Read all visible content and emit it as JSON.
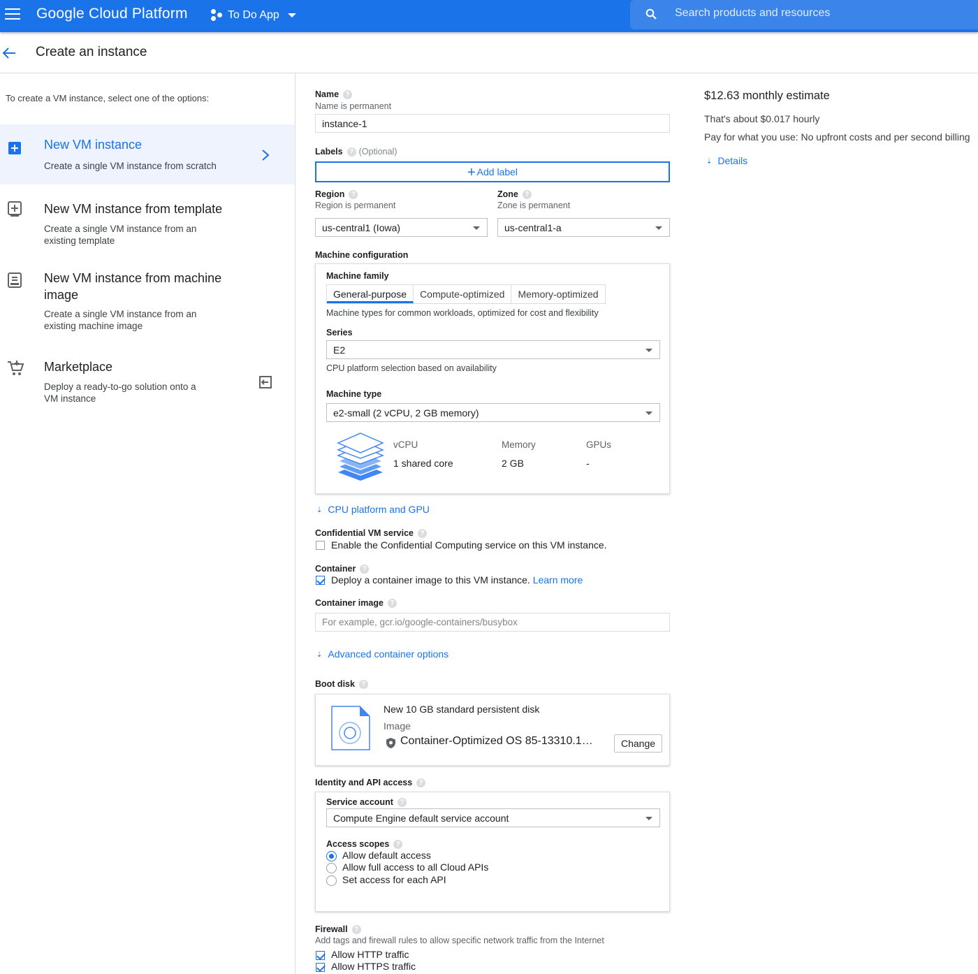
{
  "topbar": {
    "brand": "Google Cloud Platform",
    "project": "To Do App",
    "search_placeholder": "Search products and resources"
  },
  "page": {
    "title": "Create an instance"
  },
  "left": {
    "intro": "To create a VM instance, select one of the options:",
    "options": [
      {
        "title": "New VM instance",
        "desc": "Create a single VM instance from scratch",
        "selected": true
      },
      {
        "title": "New VM instance from template",
        "desc": "Create a single VM instance from an existing template"
      },
      {
        "title": "New VM instance from machine image",
        "desc": "Create a single VM instance from an existing machine image"
      },
      {
        "title": "Marketplace",
        "desc": "Deploy a ready-to-go solution onto a VM instance"
      }
    ]
  },
  "form": {
    "name_label": "Name",
    "name_hint": "Name is permanent",
    "name_value": "instance-1",
    "labels_label": "Labels",
    "labels_optional": "(Optional)",
    "add_label": "Add label",
    "region_label": "Region",
    "region_hint": "Region is permanent",
    "region_value": "us-central1 (Iowa)",
    "zone_label": "Zone",
    "zone_hint": "Zone is permanent",
    "zone_value": "us-central1-a",
    "machine_config_label": "Machine configuration",
    "machine_family_label": "Machine family",
    "tabs": [
      "General-purpose",
      "Compute-optimized",
      "Memory-optimized"
    ],
    "family_desc": "Machine types for common workloads, optimized for cost and flexibility",
    "series_label": "Series",
    "series_value": "E2",
    "series_hint": "CPU platform selection based on availability",
    "machine_type_label": "Machine type",
    "machine_type_value": "e2-small (2 vCPU, 2 GB memory)",
    "specs": {
      "vcpu_h": "vCPU",
      "vcpu_v": "1 shared core",
      "mem_h": "Memory",
      "mem_v": "2 GB",
      "gpu_h": "GPUs",
      "gpu_v": "-"
    },
    "cpu_gpu_link": "CPU platform and GPU",
    "confidential_label": "Confidential VM service",
    "confidential_text": "Enable the Confidential Computing service on this VM instance.",
    "container_label": "Container",
    "container_text": "Deploy a container image to this VM instance.",
    "learn_more": "Learn more",
    "container_image_label": "Container image",
    "container_image_placeholder": "For example, gcr.io/google-containers/busybox",
    "adv_container_link": "Advanced container options",
    "boot_disk_label": "Boot disk",
    "boot_disk_title": "New 10 GB standard persistent disk",
    "boot_disk_image_label": "Image",
    "boot_disk_image": "Container-Optimized OS 85-13310.1…",
    "change_button": "Change",
    "identity_label": "Identity and API access",
    "service_account_label": "Service account",
    "service_account_value": "Compute Engine default service account",
    "access_scopes_label": "Access scopes",
    "scopes": [
      "Allow default access",
      "Allow full access to all Cloud APIs",
      "Set access for each API"
    ],
    "firewall_label": "Firewall",
    "firewall_hint": "Add tags and firewall rules to allow specific network traffic from the Internet",
    "http": "Allow HTTP traffic",
    "https": "Allow HTTPS traffic"
  },
  "estimate": {
    "monthly": "$12.63 monthly estimate",
    "hourly": "That's about $0.017 hourly",
    "billing": "Pay for what you use: No upfront costs and per second billing",
    "details": "Details"
  },
  "colors": {
    "accent": "#1a73e8",
    "selected_bg": "#eef3fd"
  }
}
